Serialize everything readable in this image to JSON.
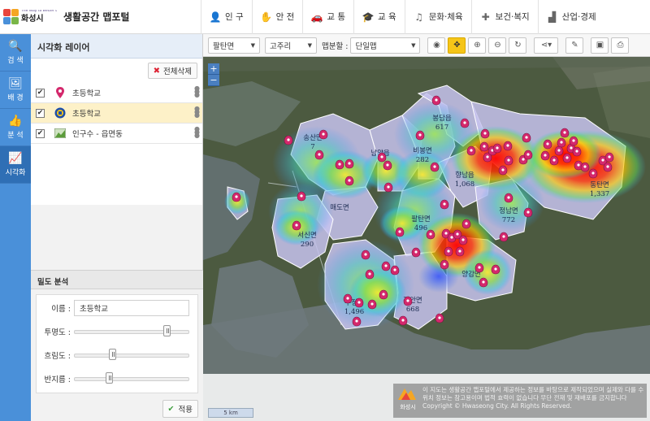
{
  "header": {
    "logo_tagline": "The Way to Better Living",
    "logo_city": "화성시",
    "app_title": "생활공간 맵포털",
    "nav": [
      {
        "label": "인 구",
        "icon": "person-icon"
      },
      {
        "label": "안 전",
        "icon": "hand-icon"
      },
      {
        "label": "교 통",
        "icon": "car-icon"
      },
      {
        "label": "교 육",
        "icon": "graduation-cap-icon"
      },
      {
        "label": "문화·체육",
        "icon": "music-note-icon"
      },
      {
        "label": "보건·복지",
        "icon": "medical-kit-icon"
      },
      {
        "label": "산업·경제",
        "icon": "factory-icon"
      }
    ]
  },
  "rail": [
    {
      "label": "검 색",
      "icon": "search-icon"
    },
    {
      "label": "배 경",
      "icon": "picture-icon"
    },
    {
      "label": "분 석",
      "icon": "thumbs-up-icon"
    },
    {
      "label": "시각화",
      "icon": "area-chart-icon",
      "active": true
    }
  ],
  "layer_panel": {
    "title": "시각화 레이어",
    "delete_all_label": "전체삭제",
    "layers": [
      {
        "name": "초등학교",
        "icon": "map-pin-icon",
        "checked": true,
        "selected": false
      },
      {
        "name": "초등학교",
        "icon": "school-badge-icon",
        "checked": true,
        "selected": true
      },
      {
        "name": "인구수 - 읍면동",
        "icon": "choropleth-icon",
        "checked": true,
        "selected": false
      }
    ]
  },
  "density": {
    "title": "밀도 분석",
    "name_label": "이름 :",
    "name_value": "초등학교",
    "transparency_label": "투명도 :",
    "transparency_value": 0.8,
    "blur_label": "흐림도 :",
    "blur_value": 0.33,
    "radius_label": "반지름 :",
    "radius_value": 0.3,
    "apply_label": "적용"
  },
  "map_toolbar": {
    "district_select": "팔탄면",
    "village_select": "고주리",
    "split_label": "맵분할 :",
    "split_select": "단일맵",
    "tools": [
      {
        "name": "globe-icon",
        "glyph": "◉"
      },
      {
        "name": "pan-icon",
        "glyph": "✥",
        "active": true
      },
      {
        "name": "zoom-in-icon",
        "glyph": "⊕"
      },
      {
        "name": "zoom-out-icon",
        "glyph": "⊖"
      },
      {
        "name": "refresh-icon",
        "glyph": "↻"
      },
      {
        "name": "share-icon",
        "glyph": "⋖▾"
      },
      {
        "name": "pencil-icon",
        "glyph": "✎"
      },
      {
        "name": "image-icon",
        "glyph": "▣"
      },
      {
        "name": "print-icon",
        "glyph": "⎙"
      }
    ]
  },
  "map": {
    "scale_label": "5 km",
    "regions": [
      {
        "name": "송산면",
        "value": "7"
      },
      {
        "name": "매도면",
        "value": ""
      },
      {
        "name": "남양읍",
        "value": ""
      },
      {
        "name": "비봉면",
        "value": "282"
      },
      {
        "name": "봉담읍",
        "value": "617"
      },
      {
        "name": "서신면",
        "value": "290"
      },
      {
        "name": "팔탄면",
        "value": "496"
      },
      {
        "name": "향남읍",
        "value": "1,068"
      },
      {
        "name": "정남면",
        "value": "772"
      },
      {
        "name": "동탄면",
        "value": "1,337"
      },
      {
        "name": "우정읍",
        "value": "1,496"
      },
      {
        "name": "장안면",
        "value": "668"
      },
      {
        "name": "양감면",
        "value": ""
      }
    ],
    "attribution_logo": "화성시",
    "attribution_lines": [
      "이 지도는 생활공간 맵포털에서 제공하는 정보를 바탕으로 제작되었으며 실제와 다를 수 있습니다",
      "위치 정보는 참고용이며 법적 효력이 없습니다 무단 전재 및 재배포를 금지합니다",
      "Copyright © Hwaseong City. All Rights Reserved."
    ]
  }
}
